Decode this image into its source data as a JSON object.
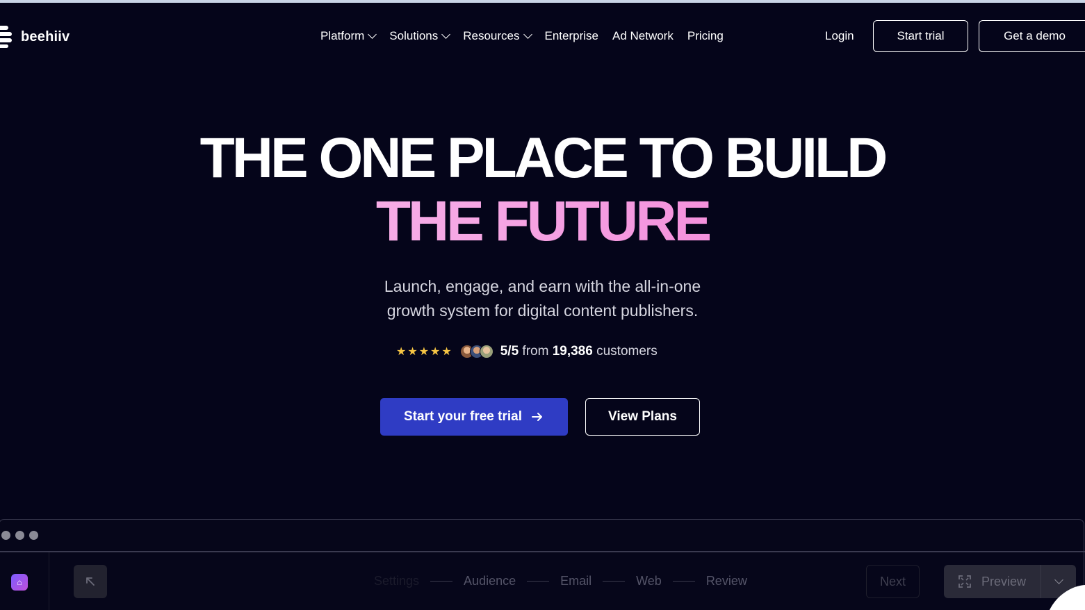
{
  "brand": {
    "name": "beehiiv",
    "logo_icon": "beehiiv-logo-icon"
  },
  "nav": {
    "items": [
      {
        "label": "Platform",
        "has_dropdown": true
      },
      {
        "label": "Solutions",
        "has_dropdown": true
      },
      {
        "label": "Resources",
        "has_dropdown": true
      },
      {
        "label": "Enterprise",
        "has_dropdown": false
      },
      {
        "label": "Ad Network",
        "has_dropdown": false
      },
      {
        "label": "Pricing",
        "has_dropdown": false
      }
    ],
    "login": "Login",
    "start_trial": "Start trial",
    "get_demo": "Get a demo"
  },
  "hero": {
    "headline_line1": "THE ONE PLACE TO BUILD",
    "headline_line2": "THE FUTURE",
    "subheadline_line1": "Launch, engage, and earn with the all-in-one",
    "subheadline_line2": "growth system for digital content publishers.",
    "rating": {
      "stars": 5,
      "score": "5/5",
      "from": "from",
      "count": "19,386",
      "customers": "customers"
    },
    "cta_primary": "Start your free trial",
    "cta_secondary": "View Plans"
  },
  "app_preview": {
    "steps": [
      "Settings",
      "Audience",
      "Email",
      "Web",
      "Review"
    ],
    "next_label": "Next",
    "preview_label": "Preview"
  },
  "colors": {
    "background": "#05051a",
    "primary_button": "#2f3cc4",
    "star": "#f6c544",
    "headline_gradient_start": "#f9c2ef",
    "headline_gradient_end": "#f06ed0"
  }
}
